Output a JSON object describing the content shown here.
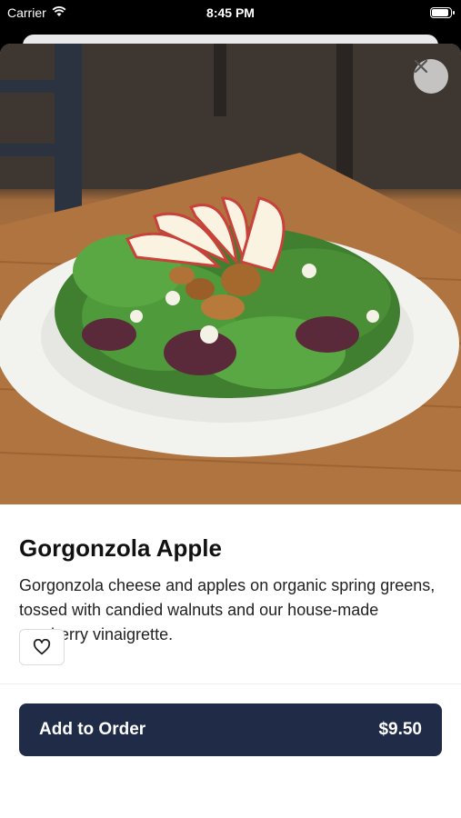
{
  "status_bar": {
    "carrier": "Carrier",
    "time": "8:45 PM",
    "wifi_icon": "wifi-icon",
    "battery_icon": "battery-icon",
    "battery_level": 1.0
  },
  "item": {
    "image_alt": "salad-photo",
    "title": "Gorgonzola Apple",
    "description": "Gorgonzola cheese and apples on organic spring greens, tossed with candied walnuts and our house-made raspberry vinaigrette."
  },
  "actions": {
    "close_icon": "close-icon",
    "favorite_icon": "heart-icon",
    "add_to_order_label": "Add to Order",
    "price": "$9.50"
  },
  "colors": {
    "primary_button": "#1f2b47",
    "background": "#ffffff"
  }
}
